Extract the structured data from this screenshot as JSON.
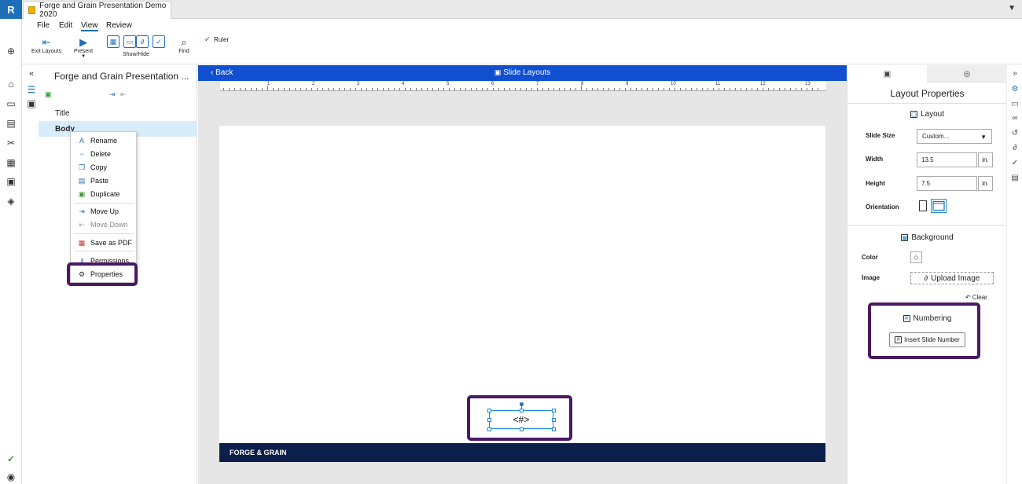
{
  "app": {
    "logo": "R",
    "tab_title": "Forge and Grain Presentation Demo 2020",
    "collapse_icon": "chevron-down-icon"
  },
  "menu": {
    "file": "File",
    "edit": "Edit",
    "view": "View",
    "review": "Review"
  },
  "ribbon": {
    "exit_layouts": "Exit Layouts",
    "present": "Present",
    "show_hide": "Show/Hide",
    "find": "Find",
    "ruler": "Ruler",
    "ruler_checked": true
  },
  "left_panel": {
    "title": "Forge and Grain Presentation ...",
    "rows": [
      "Title",
      "Body"
    ],
    "selected": "Body"
  },
  "context_menu": {
    "items": [
      {
        "label": "Rename",
        "icon": "rename-icon",
        "enabled": true
      },
      {
        "label": "Delete",
        "icon": "delete-icon",
        "enabled": true
      },
      {
        "label": "Copy",
        "icon": "copy-icon",
        "enabled": true
      },
      {
        "label": "Paste",
        "icon": "paste-icon",
        "enabled": true
      },
      {
        "label": "Duplicate",
        "icon": "duplicate-icon",
        "enabled": true
      },
      {
        "label": "Move Up",
        "icon": "move-up-icon",
        "enabled": true
      },
      {
        "label": "Move Down",
        "icon": "move-down-icon",
        "enabled": false
      },
      {
        "label": "Save as PDF",
        "icon": "pdf-icon",
        "enabled": true
      },
      {
        "label": "Permissions",
        "icon": "permissions-icon",
        "enabled": true
      },
      {
        "label": "Properties",
        "icon": "gear-icon",
        "enabled": true
      }
    ]
  },
  "center": {
    "back": "Back",
    "bar_title": "Slide Layouts",
    "ruler_numbers": [
      "1",
      "2",
      "3",
      "4",
      "5",
      "6",
      "7",
      "8",
      "9",
      "10",
      "11",
      "12",
      "13"
    ],
    "slide_number_placeholder": "<#>",
    "footer_text": "FORGE & GRAIN"
  },
  "right_panel": {
    "title": "Layout Properties",
    "layout_section": "Layout",
    "slide_size_label": "Slide Size",
    "slide_size_value": "Custom...",
    "width_label": "Width",
    "width_value": "13.5",
    "height_label": "Height",
    "height_value": "7.5",
    "unit": "in.",
    "orientation_label": "Orientation",
    "orientation_selected": "landscape",
    "background_section": "Background",
    "color_label": "Color",
    "image_label": "Image",
    "upload_image": "Upload Image",
    "clear": "Clear",
    "numbering_section": "Numbering",
    "insert_slide_number": "Insert Slide Number"
  },
  "colors": {
    "accent": "#0f4fd0",
    "highlight": "#4a1a63",
    "footer_band": "#0c1f4a",
    "selection": "#d9ecfa"
  }
}
